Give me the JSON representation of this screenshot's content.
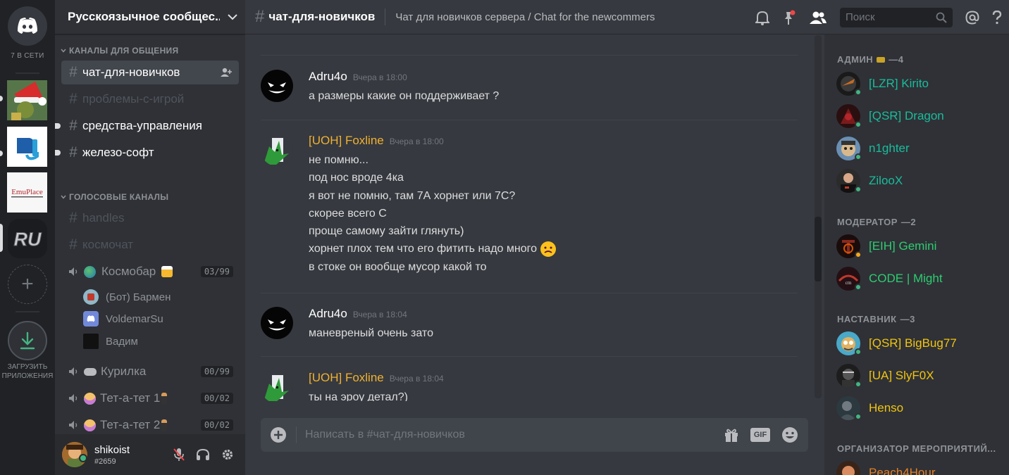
{
  "guilds": {
    "online_label": "7 В СЕТИ",
    "download_label_1": "ЗАГРУЗИТЬ",
    "download_label_2": "ПРИЛОЖЕНИЯ",
    "emuplace_text": "EmuPlace",
    "ru_text": "RU"
  },
  "server": {
    "name": "Русскоязычное сообщес...",
    "text_category": "КАНАЛЫ ДЛЯ ОБЩЕНИЯ",
    "voice_category": "ГОЛОСОВЫЕ КАНАЛЫ",
    "text_channels": [
      {
        "name": "чат-для-новичков",
        "state": "active"
      },
      {
        "name": "проблемы-с-игрой",
        "state": "muted"
      },
      {
        "name": "средства-управления",
        "state": "unread"
      },
      {
        "name": "железо-софт",
        "state": "unread"
      }
    ],
    "muted_channels": [
      {
        "name": "handles"
      },
      {
        "name": "космочат"
      }
    ],
    "voice_channels": [
      {
        "name": "Космобар",
        "count": "03/99"
      },
      {
        "name": "Курилка",
        "count": "00/99"
      },
      {
        "name": "Тет-а-тет 1",
        "count": "00/02"
      },
      {
        "name": "Тет-а-тет 2",
        "count": "00/02"
      }
    ],
    "voice_users": [
      "(Бот) Бармен",
      "VoldemarSu",
      "Вадим"
    ]
  },
  "me": {
    "name": "shikoist",
    "tag": "#2659"
  },
  "channel": {
    "name": "чат-для-новичков",
    "topic": "Чат для новичков сервера / Chat for the newcommers"
  },
  "search": {
    "placeholder": "Поиск"
  },
  "messages": [
    {
      "author": "Adru4o",
      "time": "Вчера в 18:00",
      "author_color": "#ffffff",
      "lines": [
        "а размеры какие он поддерживает ?"
      ]
    },
    {
      "author": "[UOH] Foxline",
      "time": "Вчера в 18:00",
      "author_color": "#f0b132",
      "lines": [
        "не помню...",
        "под нос вроде 4ка",
        "я вот не помню, там 7А хорнет или 7С?",
        "скорее всего С",
        "проще самому зайти глянуть)",
        "хорнет плох тем что его фитить надо много",
        "в стоке он вообще мусор какой то"
      ]
    },
    {
      "author": "Adru4o",
      "time": "Вчера в 18:04",
      "author_color": "#ffffff",
      "lines": [
        "маневреный очень зато"
      ]
    },
    {
      "author": "[UOH] Foxline",
      "time": "Вчера в 18:04",
      "author_color": "#f0b132",
      "lines": [
        "ты на эроу детал?)"
      ]
    }
  ],
  "composer": {
    "placeholder": "Написать в #чат-для-новичков",
    "gif_label": "GIF"
  },
  "members": {
    "roles": [
      {
        "title": "АДМИН",
        "count": "—4",
        "color": "#1abc9c",
        "users": [
          "[LZR] Kirito",
          "[QSR] Dragon",
          "n1ghter",
          "ZilooX"
        ]
      },
      {
        "title": "МОДЕРАТОР",
        "count": "—2",
        "color": "#2ecc71",
        "users": [
          "[EIH] Gemini",
          "CODE | Might"
        ]
      },
      {
        "title": "НАСТАВНИК",
        "count": "—3",
        "color": "#f1c40f",
        "users": [
          "[QSR] BigBug77",
          "[UA] SlyF0X",
          "Henso"
        ]
      },
      {
        "title": "ОРГАНИЗАТОР МЕРОПРИЯТИЙ...",
        "count": "",
        "color": "#e67e22",
        "users": [
          "Peach4Hour"
        ]
      }
    ]
  }
}
